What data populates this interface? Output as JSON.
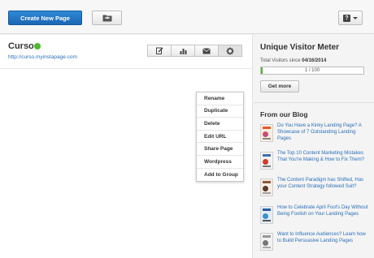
{
  "toolbar": {
    "create_label": "Create New Page",
    "folder_icon": "folder-icon",
    "help_icon": "help-icon",
    "help_glyph": "?"
  },
  "page": {
    "title": "Curso",
    "status_color": "#4fb82f",
    "url": "http://curso.myinstapage.com",
    "actions": [
      {
        "icon": "edit-icon"
      },
      {
        "icon": "stats-icon"
      },
      {
        "icon": "mail-icon"
      },
      {
        "icon": "gear-icon"
      }
    ]
  },
  "menu": {
    "items": [
      "Rename",
      "Duplicate",
      "Delete",
      "Edit URL",
      "Share Page",
      "Wordpress",
      "Add to Group"
    ]
  },
  "meter": {
    "title": "Unique Visitor Meter",
    "label": "Total Visitors since",
    "date": "04/16/2014",
    "value": 1,
    "max": 100,
    "display": "1 / 100",
    "fill_color": "#4fb82f",
    "button": "Get more"
  },
  "blog": {
    "title": "From our Blog",
    "posts": [
      {
        "title": "Do You Have a Kinky Landing Page? A Showcase of 7 Outstanding Landing Pages"
      },
      {
        "title": "The Top 10 Content Marketing Mistakes That You're Making & How to Fix Them?"
      },
      {
        "title": "The Content Paradigm has Shifted, Has your Content Strategy followed Suit?"
      },
      {
        "title": "How to Celebrate April Fool's Day Without Being Foolish on Your Landing Pages"
      },
      {
        "title": "Want to Influence Audiences? Learn how to Build Persuasive Landing Pages"
      }
    ]
  },
  "colors": {
    "primary": "#1f72c2",
    "link": "#2a6fb8",
    "success": "#4fb82f"
  }
}
